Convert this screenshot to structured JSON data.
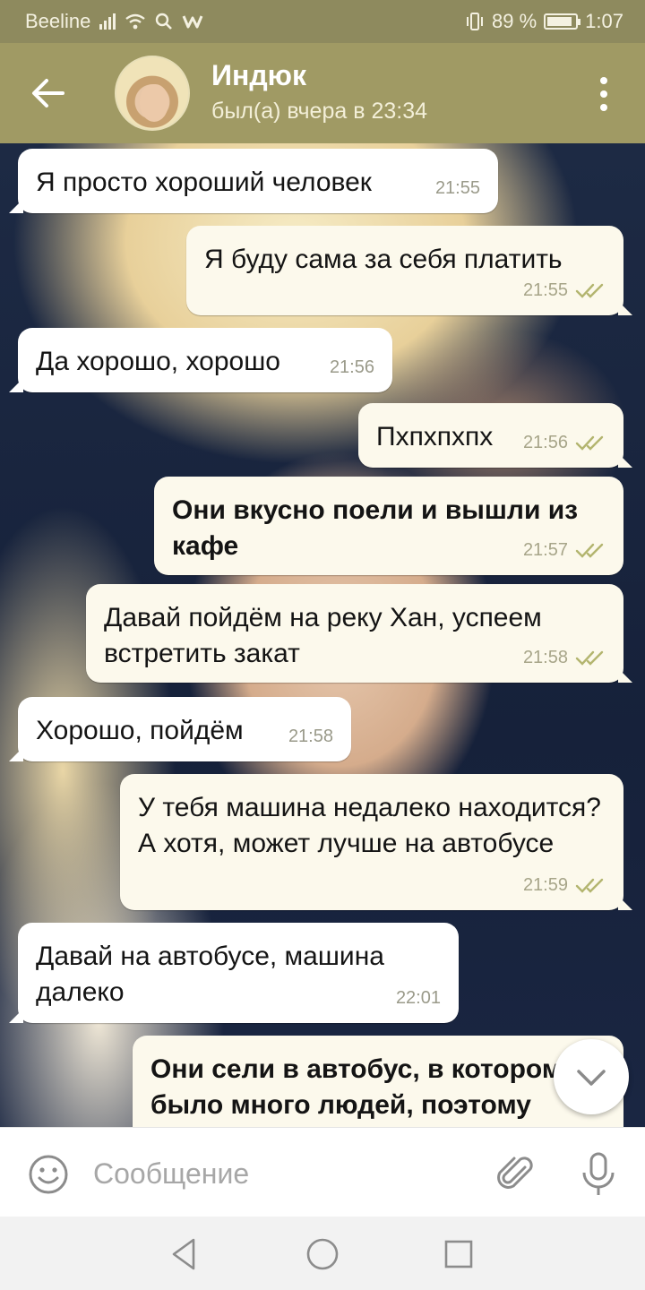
{
  "status_bar": {
    "carrier": "Beeline",
    "battery_percent": "89 %",
    "battery_level": 0.89,
    "time": "1:07"
  },
  "header": {
    "title": "Индюк",
    "subtitle": "был(а) вчера в 23:34"
  },
  "messages": [
    {
      "text": "Я просто хороший человек",
      "time": "21:55",
      "direction": "in",
      "bold": false
    },
    {
      "text": "Я буду сама за себя платить",
      "time": "21:55",
      "direction": "out",
      "bold": false,
      "read": true
    },
    {
      "text": "Да хорошо, хорошо",
      "time": "21:56",
      "direction": "in",
      "bold": false
    },
    {
      "text": "Пхпхпхпх",
      "time": "21:56",
      "direction": "out",
      "bold": false,
      "read": true
    },
    {
      "text": "Они вкусно поели и вышли из кафе",
      "time": "21:57",
      "direction": "out",
      "bold": true,
      "read": true
    },
    {
      "text": "Давай пойдём на реку Хан, успеем встретить закат",
      "time": "21:58",
      "direction": "out",
      "bold": false,
      "read": true
    },
    {
      "text": "Хорошо, пойдём",
      "time": "21:58",
      "direction": "in",
      "bold": false
    },
    {
      "text": "У тебя машина недалеко находится? А хотя, может лучше на автобусе",
      "time": "21:59",
      "direction": "out",
      "bold": false,
      "read": true
    },
    {
      "text": "Давай на автобусе, машина далеко",
      "time": "22:01",
      "direction": "in",
      "bold": false
    },
    {
      "text": "Они сели в автобус, в котором было много людей, поэтому",
      "time": "",
      "direction": "out",
      "bold": true
    }
  ],
  "composer": {
    "placeholder": "Сообщение"
  },
  "icons": {
    "back": "arrow-left-icon",
    "menu": "more-vertical-icon",
    "emoji": "smiley-icon",
    "attach": "paperclip-icon",
    "mic": "microphone-icon",
    "scroll": "chevron-down-icon",
    "read": "double-check-icon"
  },
  "colors": {
    "header": "#a09a64",
    "status_bar": "#8e8a5e",
    "outgoing": "#fcf9ec",
    "incoming": "#ffffff",
    "check": "#b3b56f"
  }
}
